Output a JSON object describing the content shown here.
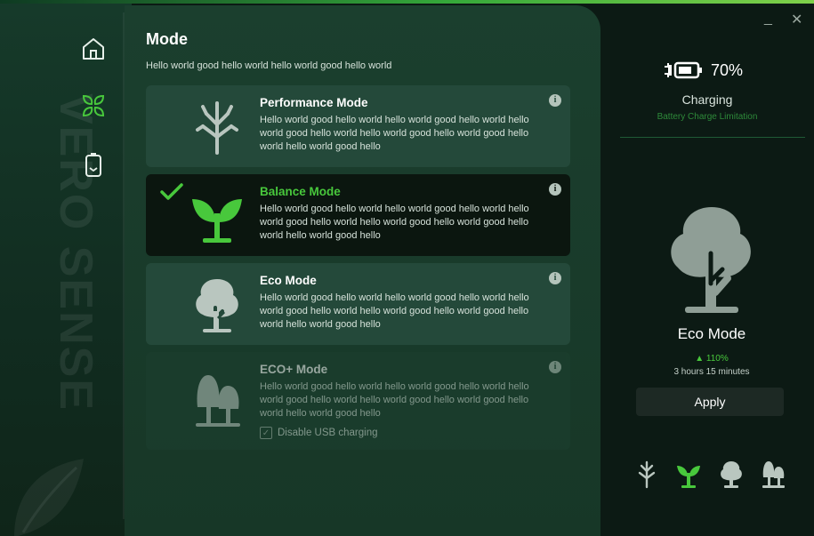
{
  "brand": {
    "text": "VERO SENSE"
  },
  "nav": {
    "items": [
      {
        "name": "home",
        "icon": "home-icon"
      },
      {
        "name": "mode",
        "icon": "leaves-icon",
        "active": true
      },
      {
        "name": "battery",
        "icon": "battery-icon"
      }
    ]
  },
  "main": {
    "title": "Mode",
    "subtitle": "Hello world good hello world hello world good hello world",
    "modes": [
      {
        "name": "Performance Mode",
        "description": "Hello world good hello world hello world good hello world hello world good hello world hello world good hello world good hello world hello world good hello",
        "icon": "bare-tree-icon",
        "state": "normal"
      },
      {
        "name": "Balance Mode",
        "description": "Hello world good hello world hello world good hello world hello world good hello world hello world good hello world good hello world hello world good hello",
        "icon": "sprout-icon",
        "state": "selected"
      },
      {
        "name": "Eco Mode",
        "description": "Hello world good hello world hello world good hello world hello world good hello world hello world good hello world good hello world hello world good hello",
        "icon": "tree-icon",
        "state": "normal"
      },
      {
        "name": "ECO+ Mode",
        "description": "Hello world good hello world hello world good hello world hello world good hello world hello world good hello world good hello world hello world good hello",
        "icon": "twin-trees-icon",
        "state": "disabled",
        "usb_label": "Disable USB charging"
      }
    ]
  },
  "status": {
    "battery_percent": "70%",
    "charging": "Charging",
    "battery_limit_link": "Battery Charge Limitation",
    "current_mode": "Eco Mode",
    "gain": "110%",
    "time_left": "3 hours 15 minutes",
    "apply_label": "Apply",
    "minimize": "_",
    "close": "✕"
  },
  "colors": {
    "accent_green": "#48c83c",
    "selected_card": "#0b160f",
    "card": "#24493a",
    "panel": "#1b3f2e"
  }
}
